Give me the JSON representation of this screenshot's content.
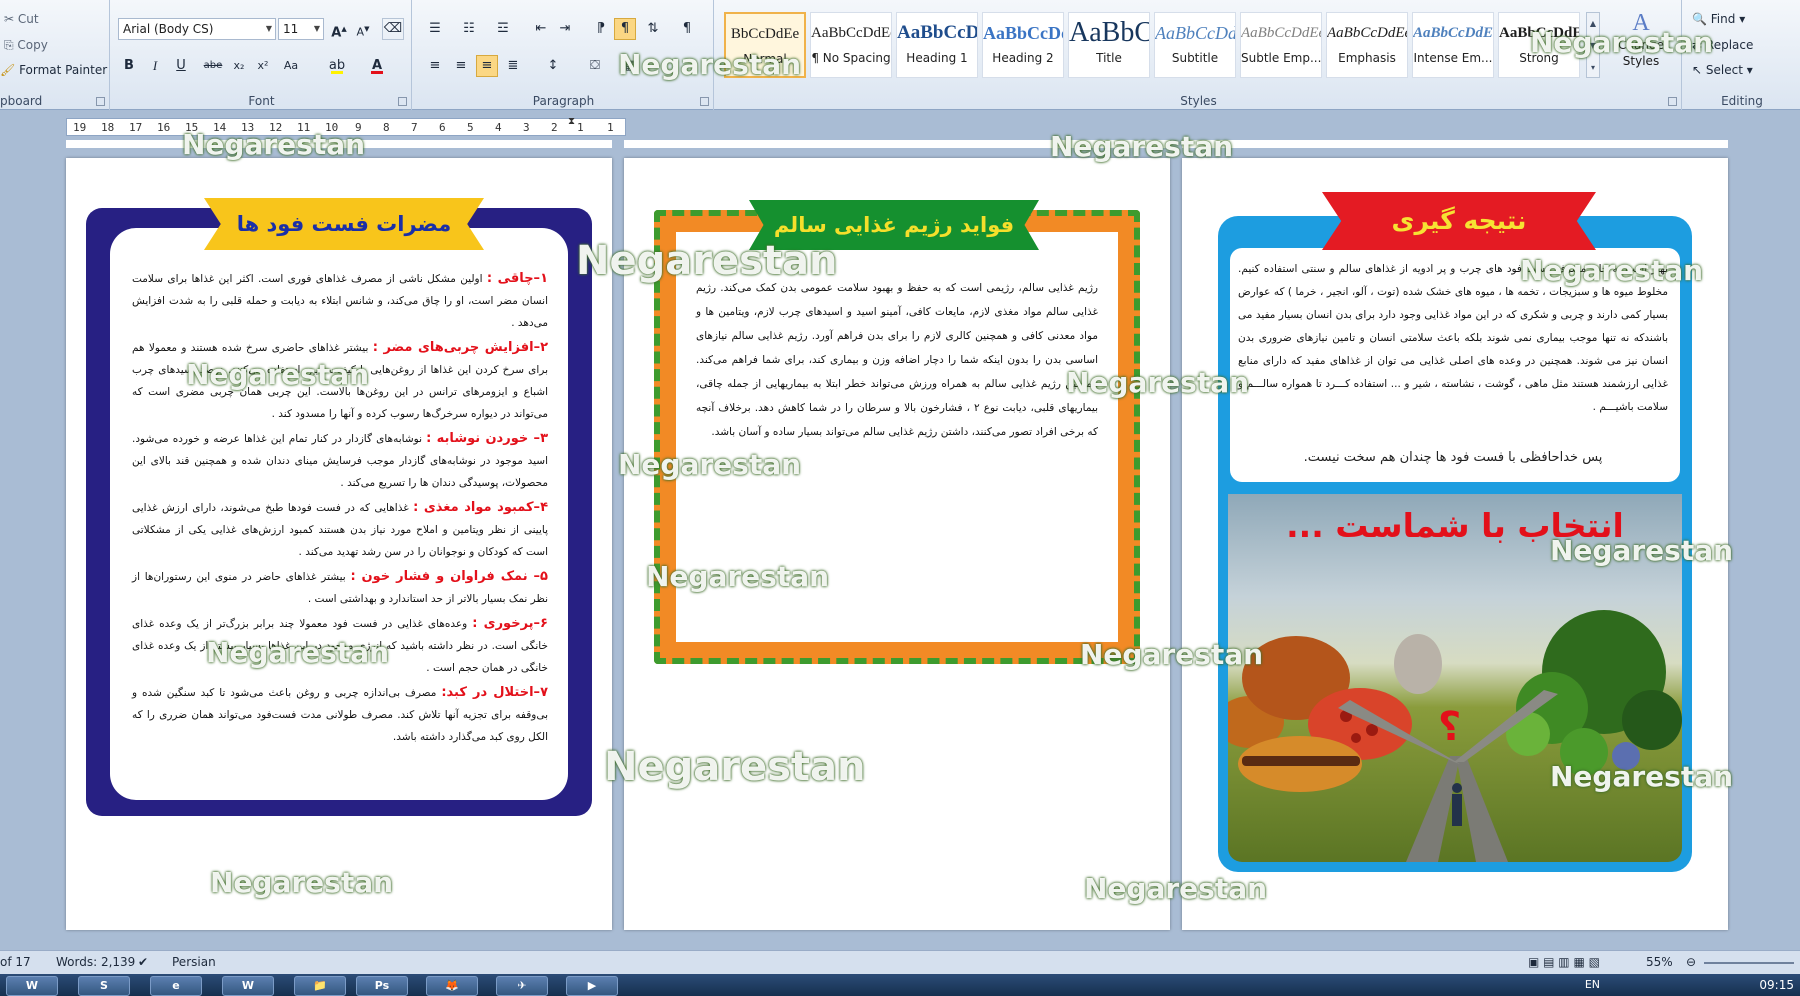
{
  "ribbon": {
    "clipboard": {
      "cut": "Cut",
      "copy": "Copy",
      "format_painter": "Format Painter",
      "label": "pboard"
    },
    "font": {
      "name": "Arial (Body CS)",
      "size": "11",
      "buttons": [
        "B",
        "I",
        "U",
        "abe",
        "x₂",
        "x²",
        "Aa"
      ],
      "label": "Font"
    },
    "paragraph": {
      "label": "Paragraph"
    },
    "styles": {
      "label": "Styles",
      "tiles": [
        {
          "sample": "BbCcDdEe",
          "name": "Normal",
          "selected": true
        },
        {
          "sample": "AaBbCcDdEe",
          "name": "¶ No Spacing",
          "selected": false
        },
        {
          "sample": "AaBbCcDdEe",
          "name": "Heading 1",
          "selected": false
        },
        {
          "sample": "AaBbCcDdEe",
          "name": "Heading 2",
          "selected": false
        },
        {
          "sample": "AaBbCcDdEe",
          "name": "Title",
          "selected": false
        },
        {
          "sample": "AaBbCcDdEe",
          "name": "Subtitle",
          "selected": false
        },
        {
          "sample": "AaBbCcDdEe",
          "name": "Subtle Emp...",
          "selected": false
        },
        {
          "sample": "AaBbCcDdEe",
          "name": "Emphasis",
          "selected": false
        },
        {
          "sample": "AaBbCcDdEe",
          "name": "Intense Em...",
          "selected": false
        },
        {
          "sample": "AaBbCcDdEe",
          "name": "Strong",
          "selected": false
        }
      ],
      "change_styles": "Change Styles"
    },
    "editing": {
      "find": "Find",
      "replace": "Replace",
      "select": "Select",
      "label": "Editing"
    }
  },
  "ruler": {
    "ticks": [
      "19",
      "18",
      "17",
      "16",
      "15",
      "14",
      "13",
      "12",
      "11",
      "10",
      "9",
      "8",
      "7",
      "6",
      "5",
      "4",
      "3",
      "2",
      "1",
      "1"
    ]
  },
  "pages": {
    "left": {
      "title": "مضرات فست فود ها",
      "items": [
        {
          "head": "۱–چاقی :",
          "body": "اولین مشکل ناشی از مصرف غذاهای فوری است. اکثر این غذاها برای سلامت انسان مضر است، او را چاق می‌کند، و شانس ابتلاء به دیابت و حمله قلبی را به شدت افزایش می‌دهد ."
        },
        {
          "head": "۲–افزایش چربی‌های مضر :",
          "body": "بیشتر غذاهای حاضری سرخ شده هستند و معمولا هم برای سرخ کردن این غذاها از روغن‌هایی با کیفیت پایین استفاده می‌کنند. درصد اسیدهای چرب اشباع و ایزومرهای ترانس در این روغن‌ها بالاست. این چربی همان چربی مضری است که می‌تواند در دیواره سرخرگ‌ها رسوب کرده و آنها را مسدود کند ."
        },
        {
          "head": "۳– خوردن نوشابه :",
          "body": "نوشابه‌های گازدار در کنار تمام این غذاها عرضه و خورده می‌شود. اسید موجود در نوشابه‌های گازدار موجب فرسایش مینای دندان شده و همچنین قند بالای این محصولات، پوسیدگی دندان ها را تسریع می‌کند ."
        },
        {
          "head": "۴–کمبود مواد مغذی :",
          "body": "غذاهایی که در فست فودها طبخ می‌شوند، دارای ارزش غذایی پایینی از نظر ویتامین و املاح مورد نیاز بدن هستند کمبود ارزش‌های غذایی یکی از مشکلاتی است که کودکان و نوجوانان را در سن رشد تهدید می‌کند ."
        },
        {
          "head": "۵– نمک فراوان و فشار خون :",
          "body": "بیشتر غذاهای حاضر در منوی این رستوران‌ها از نظر نمک بسیار بالاتر از حد استاندارد و بهداشتی است ."
        },
        {
          "head": "۶–پرخوری :",
          "body": "وعده‌های غذایی در فست فود معمولا چند برابر بزرگ‌تر از یک وعده غذای خانگی است. در نظر داشته باشید که انرژی موجود در این غذاها بسیار بیشتر از یک وعده غذای خانگی در همان حجم است ."
        },
        {
          "head": "۷–اختلال در کبد:",
          "body": "مصرف بی‌اندازه چربی و روغن باعث می‌شود تا کبد سنگین شده و بی‌وقفه برای تجزیه آنها تلاش کند. مصرف طولانی مدت فست‌فود می‌تواند همان ضرری را که الکل روی کبد می‌گذارد داشته باشد."
        }
      ]
    },
    "middle": {
      "title": "فواید رژیم غذایی سالم",
      "body": "رژیم غذایی سالم، رژیمی است که به حفظ و بهبود سلامت عمومی بدن کمک می‌کند. رژیم غذایی سالم مواد مغذی لازم، مایعات کافی، آمینو اسید و اسیدهای چرب لازم، ویتامین ها و مواد معدنی کافی و همچنین کالری لازم را برای بدن فراهم آورد. رژیم غذایی سالم نیازهای اساسی بدن را بدون اینکه شما را دچار اضافه وزن و بیماری کند، برای شما فراهم می‌کند. همچنین رژیم غذایی سالم به همراه ورزش می‌تواند خطر ابتلا به بیماریهایی از جمله چاقی، بیماریهای قلبی، دیابت نوع ۲ ، فشارخون بالا و سرطان را در شما کاهش دهد. برخلاف آنچه که برخی افراد تصور می‌کنند، داشتن رژیم غذایی سالم می‌تواند بسیار ساده و آسان باشد."
    },
    "right": {
      "title": "نتیجه گیری",
      "body": "بهتر است به جای مصرف فست فود های چرب و پر ادویه از غذاهای سالم و سنتی استفاده کنیم. مخلوط میوه ها و سبزیجات ، تخمه ها ، میوه های خشک شده (توت ، آلو، انجیر ، خرما ) که عوارض بسیار کمی دارند و چربی و شکری که در این مواد غذایی وجود دارد برای بدن انسان بسیار مفید می باشندکه نه تنها موجب بیماری نمی شوند بلکه باعث سلامتی انسان و تامین نیازهای ضروری بدن انسان نیز می شوند. همچنین در وعده های اصلی غذایی می توان از غذاهای مفید که دارای منابع غذایی ارزشمند هستند مثل ماهی ، گوشت ، نشاسته ، شیر و ... استفاده کـــرد تا همواره سالـــم و سلامت باشیـــم .",
      "note": "پس خداحافظی با فست فود ها چندان هم سخت نیست.",
      "choice": "انتخاب با شماست ...",
      "question_mark": "؟"
    }
  },
  "watermark": "Negarestan",
  "statusbar": {
    "page": "of 17",
    "words": "Words: 2,139",
    "language": "Persian",
    "zoom": "55%"
  },
  "taskbar": {
    "apps": [
      "W",
      "S",
      "e",
      "W",
      "📁",
      "Ps",
      "🦊",
      "✈",
      "▶"
    ],
    "lang": "EN",
    "clock": "09:15"
  }
}
